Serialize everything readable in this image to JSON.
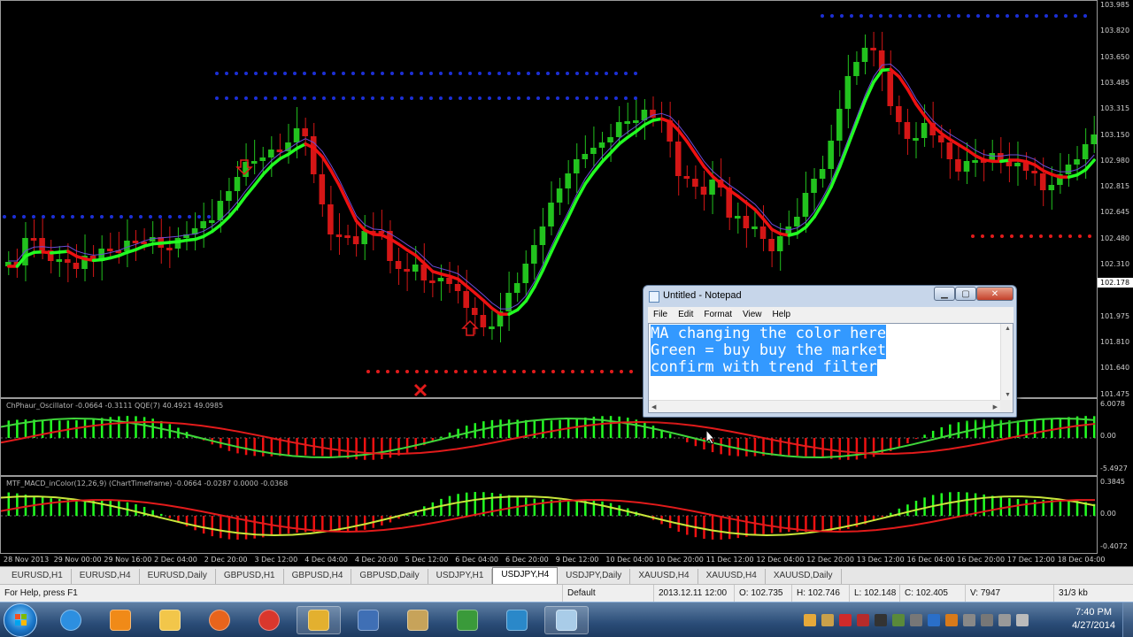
{
  "chart": {
    "main_axis_ticks": [
      "103.985",
      "103.820",
      "103.650",
      "103.485",
      "103.315",
      "103.150",
      "102.980",
      "102.815",
      "102.645",
      "102.480",
      "102.310",
      "102.178",
      "101.975",
      "101.810",
      "101.640",
      "101.475"
    ],
    "current_price": "102.178",
    "osc1_label": "ChPhaur_Oscillator -0.0664 -0.3111  QQE(7) 40.4921 49.0985",
    "osc1_ticks": [
      "6.0078",
      "0.00",
      "-5.4927"
    ],
    "osc2_label": "MTF_MACD_inColor(12,26,9) (ChartTimeframe) -0.0664 -0.0287 0.0000 -0.0368",
    "osc2_ticks": [
      "0.3845",
      "0.00",
      "-0.4072"
    ],
    "time_labels": [
      "28 Nov 2013",
      "29 Nov 00:00",
      "29 Nov 16:00",
      "2 Dec 04:00",
      "2 Dec 20:00",
      "3 Dec 12:00",
      "4 Dec 04:00",
      "4 Dec 20:00",
      "5 Dec 12:00",
      "6 Dec 04:00",
      "6 Dec 20:00",
      "9 Dec 12:00",
      "10 Dec 04:00",
      "10 Dec 20:00",
      "11 Dec 12:00",
      "12 Dec 04:00",
      "12 Dec 20:00",
      "13 Dec 12:00",
      "16 Dec 04:00",
      "16 Dec 20:00",
      "17 Dec 12:00",
      "18 Dec 04:00"
    ],
    "colors": {
      "bull": "#22c21e",
      "bear": "#d41616",
      "ma_up": "#22ff22",
      "ma_down": "#ee1111",
      "dots_blue": "#1c2fd6",
      "dots_red": "#e21b1b"
    }
  },
  "tabs": [
    "EURUSD,H1",
    "EURUSD,H4",
    "EURUSD,Daily",
    "GBPUSD,H1",
    "GBPUSD,H4",
    "GBPUSD,Daily",
    "USDJPY,H1",
    "USDJPY,H4",
    "USDJPY,Daily",
    "XAUUSD,H4",
    "XAUUSD,H4",
    "XAUUSD,Daily"
  ],
  "active_tab": "USDJPY,H4",
  "status": {
    "help": "For Help, press F1",
    "profile": "Default",
    "time": "2013.12.11 12:00",
    "open": "O: 102.735",
    "high": "H: 102.746",
    "low": "L: 102.148",
    "close": "C: 102.405",
    "volume": "V: 7947",
    "traffic": "31/3 kb"
  },
  "notepad": {
    "title": "Untitled - Notepad",
    "menu": [
      "File",
      "Edit",
      "Format",
      "View",
      "Help"
    ],
    "lines": [
      "MA changing the color here",
      "Green = buy buy the market",
      "confirm with trend filter"
    ]
  },
  "taskbar": {
    "icons": [
      "ie-icon",
      "vlc-icon",
      "folder-icon",
      "firefox-icon",
      "chrome-icon",
      "metatrader-icon",
      "remote-icon",
      "alpari-icon",
      "forex-icon",
      "browser-icon",
      "notepad-icon"
    ],
    "time": "7:40 PM",
    "date": "4/27/2014"
  }
}
